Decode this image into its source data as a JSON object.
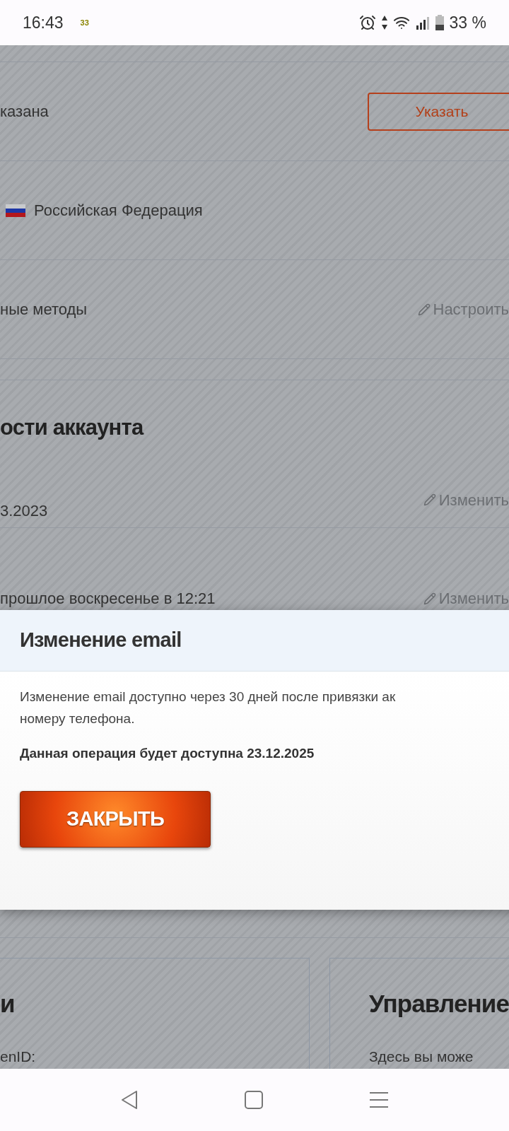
{
  "status_bar": {
    "time": "16:43",
    "notification": "33",
    "battery": "33 %"
  },
  "background_page": {
    "rows": [
      {
        "kind": "button",
        "value": "казана",
        "action": "Указать"
      },
      {
        "kind": "flag",
        "value": "Российская Федерация"
      },
      {
        "kind": "link",
        "value": "ные методы",
        "action": "Настроить"
      }
    ],
    "section_title": "ости аккаунта",
    "section_rows": [
      {
        "value": "3.2023",
        "action": "Изменить"
      },
      {
        "value": "прошлое воскресенье в 12:21",
        "action": "Изменить"
      }
    ],
    "cards": [
      {
        "title": "и",
        "text": "enID:"
      },
      {
        "title": "Управление",
        "text": "Здесь вы може"
      }
    ]
  },
  "dialog": {
    "title": "Изменение email",
    "message_lines": [
      "Изменение email доступно через 30 дней после привязки ак",
      "номеру телефона."
    ],
    "note": "Данная операция будет доступна 23.12.2025",
    "button": "ЗАКРЫТЬ"
  }
}
